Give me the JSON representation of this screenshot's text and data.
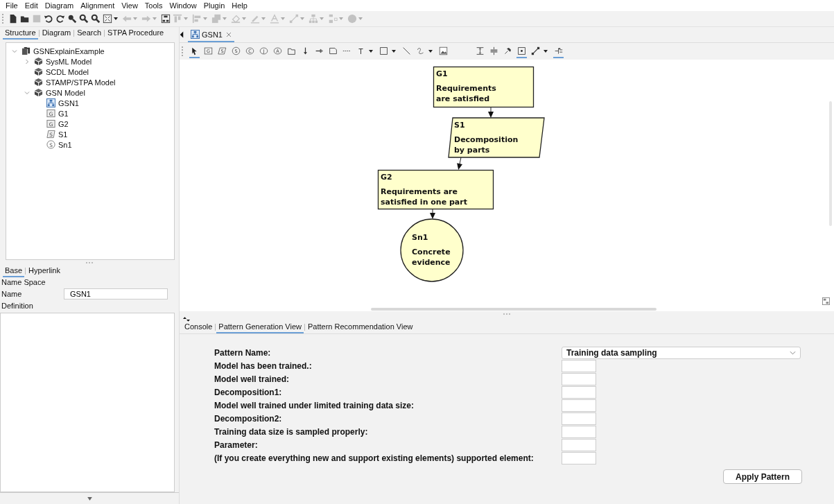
{
  "menu": [
    "File",
    "Edit",
    "Diagram",
    "Alignment",
    "View",
    "Tools",
    "Window",
    "Plugin",
    "Help"
  ],
  "toolbar": [
    {
      "kind": "new",
      "disabled": false,
      "dropdown": false
    },
    {
      "kind": "open",
      "disabled": false,
      "dropdown": false
    },
    {
      "kind": "save",
      "disabled": true,
      "dropdown": false
    },
    {
      "kind": "undo",
      "disabled": false,
      "dropdown": false
    },
    {
      "kind": "redo",
      "disabled": false,
      "dropdown": false
    },
    {
      "kind": "zoom",
      "disabled": false,
      "dropdown": false
    },
    {
      "kind": "zoom-in",
      "disabled": false,
      "dropdown": false
    },
    {
      "kind": "zoom-out",
      "disabled": false,
      "dropdown": false
    },
    {
      "kind": "fit",
      "disabled": false,
      "dropdown": true
    },
    {
      "kind": "back",
      "disabled": true,
      "dropdown": true
    },
    {
      "kind": "forward",
      "disabled": true,
      "dropdown": true
    },
    {
      "kind": "layout",
      "disabled": false,
      "dropdown": false
    },
    {
      "kind": "align-top",
      "disabled": true,
      "dropdown": true
    },
    {
      "kind": "align-left",
      "disabled": true,
      "dropdown": true
    },
    {
      "kind": "arrange",
      "disabled": true,
      "dropdown": true
    },
    {
      "kind": "fill",
      "disabled": true,
      "dropdown": true
    },
    {
      "kind": "pen",
      "disabled": true,
      "dropdown": true
    },
    {
      "kind": "font",
      "disabled": true,
      "dropdown": true
    },
    {
      "kind": "connector",
      "disabled": true,
      "dropdown": true
    },
    {
      "kind": "tree",
      "disabled": true,
      "dropdown": true
    },
    {
      "kind": "distribute",
      "disabled": true,
      "dropdown": true
    },
    {
      "kind": "smiley",
      "disabled": true,
      "dropdown": true
    }
  ],
  "left_tabs": [
    {
      "label": "Structure",
      "selected": true
    },
    {
      "label": "Diagram",
      "selected": false
    },
    {
      "label": "Search",
      "selected": false
    },
    {
      "label": "STPA Procedure",
      "selected": false
    }
  ],
  "tree": [
    {
      "label": "GSNExplainExample",
      "kind": "project",
      "expanded": true,
      "children": [
        {
          "label": "SysML Model",
          "kind": "model",
          "expanded": false
        },
        {
          "label": "SCDL Model",
          "kind": "model"
        },
        {
          "label": "STAMP/STPA Model",
          "kind": "model"
        },
        {
          "label": "GSN Model",
          "kind": "model",
          "expanded": true,
          "children": [
            {
              "label": "GSN1",
              "kind": "diagram"
            },
            {
              "label": "G1",
              "kind": "goal",
              "glyph": "G"
            },
            {
              "label": "G2",
              "kind": "goal",
              "glyph": "G"
            },
            {
              "label": "S1",
              "kind": "strategy",
              "glyph": "S"
            },
            {
              "label": "Sn1",
              "kind": "solution",
              "glyph": "S"
            }
          ]
        }
      ]
    }
  ],
  "property_tabs": [
    {
      "label": "Base",
      "selected": true
    },
    {
      "label": "Hyperlink",
      "selected": false
    }
  ],
  "properties": {
    "name_space_label": "Name Space",
    "name_label": "Name",
    "name_value": "GSN1",
    "definition_label": "Definition"
  },
  "editor_tabs": [
    {
      "label": "GSN1",
      "selected": true
    }
  ],
  "palette": [
    {
      "kind": "select",
      "selected": true
    },
    {
      "kind": "goal",
      "glyph": "G",
      "selected": false
    },
    {
      "kind": "strategy",
      "glyph": "S",
      "selected": false
    },
    {
      "kind": "solution",
      "glyph": "S",
      "selected": false
    },
    {
      "kind": "context",
      "glyph": "C",
      "selected": false
    },
    {
      "kind": "justification",
      "glyph": "J",
      "selected": false
    },
    {
      "kind": "assumption",
      "glyph": "A",
      "selected": false
    },
    {
      "kind": "module",
      "selected": false
    },
    {
      "kind": "supported-by",
      "selected": false
    },
    {
      "kind": "in-context-of",
      "selected": false
    },
    {
      "kind": "note",
      "selected": false
    },
    {
      "kind": "dashed-line",
      "selected": false
    },
    {
      "kind": "text",
      "glyph": "T",
      "selected": false,
      "dropdown": true
    },
    {
      "kind": "rectangle",
      "selected": false,
      "dropdown": true
    },
    {
      "kind": "line",
      "selected": false
    },
    {
      "kind": "curve",
      "selected": false,
      "dropdown": true
    },
    {
      "kind": "image",
      "selected": false
    },
    {
      "kind": "gap"
    },
    {
      "kind": "space-vertical",
      "selected": false
    },
    {
      "kind": "compress-vertical",
      "selected": false
    },
    {
      "kind": "pin",
      "selected": false
    },
    {
      "kind": "snap",
      "selected": true
    },
    {
      "kind": "connector",
      "selected": false,
      "dropdown": true
    },
    {
      "kind": "align",
      "selected": true
    }
  ],
  "diagram": {
    "nodes": [
      {
        "kind": "goal",
        "id_label": "G1",
        "lines": [
          "Requirements",
          "are satisfied"
        ]
      },
      {
        "kind": "strategy",
        "id_label": "S1",
        "lines": [
          "Decomposition",
          "by parts"
        ],
        "arrow_in": true
      },
      {
        "kind": "goal",
        "id_label": "G2",
        "lines": [
          "Requirements are",
          "satisfied in one part"
        ],
        "arrow_in": true
      },
      {
        "kind": "solution",
        "id_label": "Sn1",
        "lines": [
          "Concrete",
          "evidence"
        ],
        "arrow_in": true
      }
    ]
  },
  "bottom_tabs": [
    {
      "label": "Console",
      "selected": false
    },
    {
      "label": "Pattern Generation View",
      "selected": true
    },
    {
      "label": "Pattern Recommendation View",
      "selected": false
    }
  ],
  "pattern_form": {
    "fields": [
      {
        "label": "Pattern Name:",
        "kind": "dropdown",
        "value": "Training data sampling"
      },
      {
        "label": "Model has been trained.:",
        "kind": "input"
      },
      {
        "label": "Model well trained:",
        "kind": "input"
      },
      {
        "label": "Decomposition1:",
        "kind": "input"
      },
      {
        "label": "Model well trained under limited training data size:",
        "kind": "input"
      },
      {
        "label": "Decomposition2:",
        "kind": "input"
      },
      {
        "label": "Training data size is sampled properly:",
        "kind": "input"
      },
      {
        "label": "Parameter:",
        "kind": "input"
      },
      {
        "label": "(If you create everything new and support existing elements) supported element:",
        "kind": "input"
      }
    ],
    "apply_button": "Apply Pattern"
  }
}
